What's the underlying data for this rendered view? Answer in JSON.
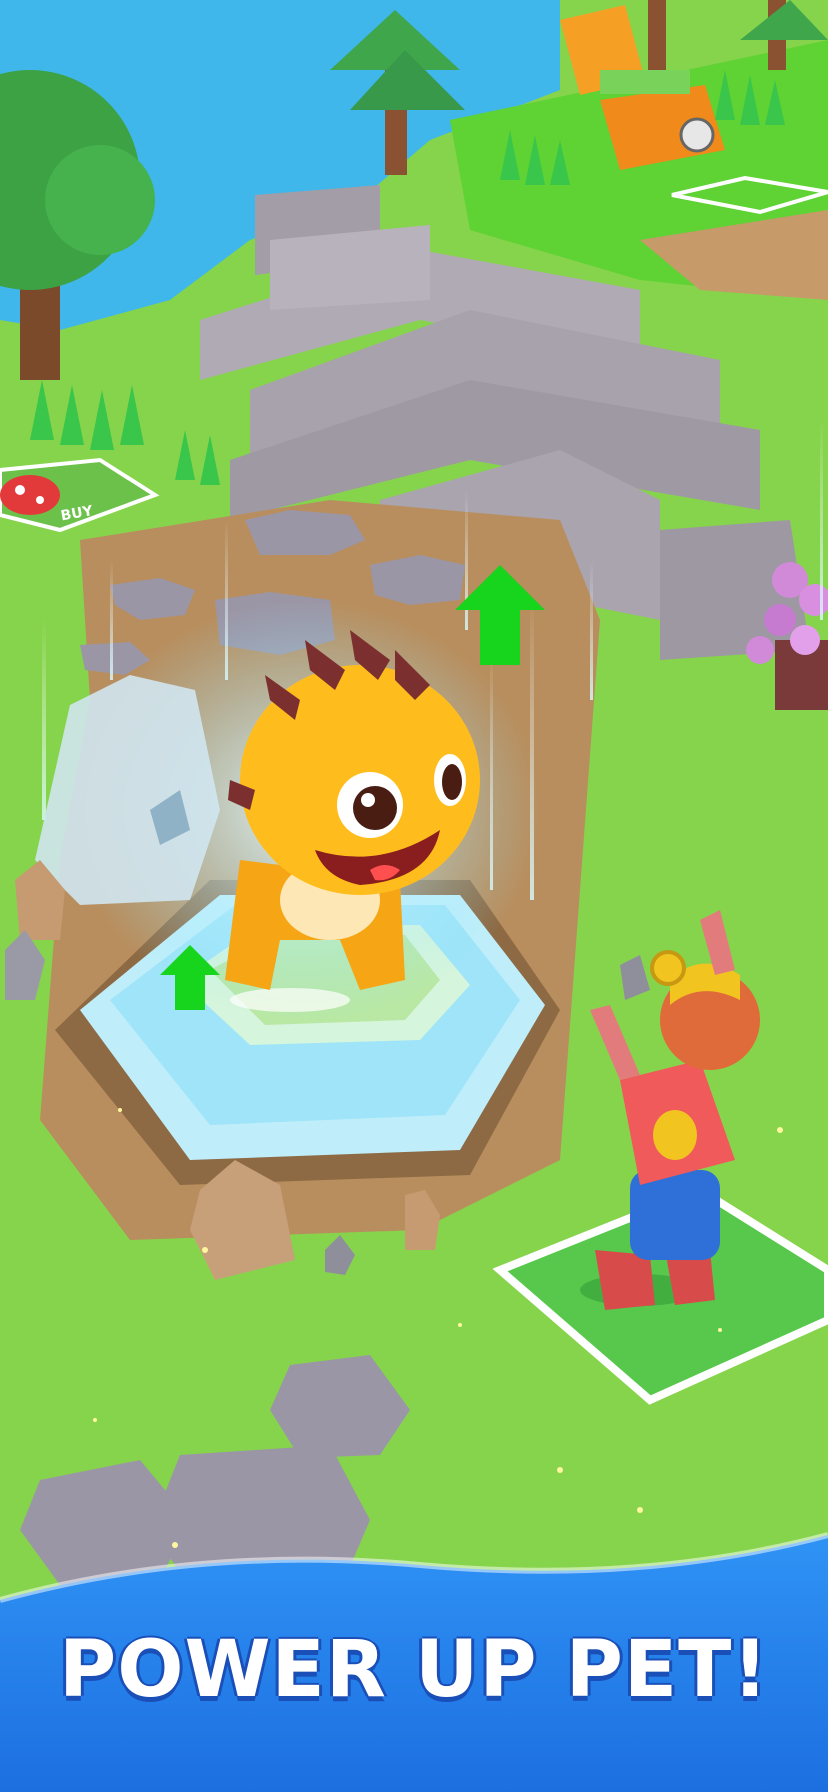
{
  "caption": {
    "text": "POWER UP PET!"
  },
  "buy_pad": {
    "label": "BUY"
  },
  "upgrade_arrows": {
    "count": 2
  },
  "colors": {
    "grass": "#7fd24a",
    "water": "#3db8ec",
    "path": "#b58a5a",
    "stone": "#a9a3ad",
    "pet_body": "#ffb81a",
    "pet_spikes": "#7a2f2c",
    "upgrade_arrow": "#19d41e",
    "banner": "#2a86f0"
  }
}
